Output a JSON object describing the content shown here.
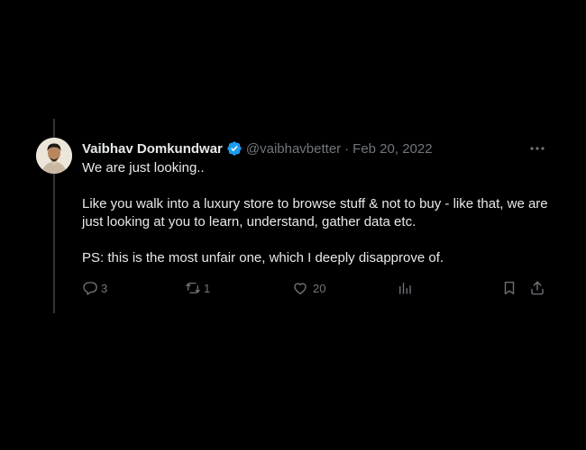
{
  "author": {
    "name": "Vaibhav Domkundwar",
    "handle": "@vaibhavbetter",
    "separator": "·",
    "date": "Feb 20, 2022",
    "verified": true
  },
  "tweet": {
    "paragraphs": [
      "We are just looking..",
      "Like you walk into a luxury store to browse stuff & not to buy - like that, we are just looking at you to learn, understand, gather data etc.",
      "PS: this is the most unfair one, which I deeply disapprove of."
    ]
  },
  "actions": {
    "replies": "3",
    "retweets": "1",
    "likes": "20"
  },
  "colors": {
    "background": "#000000",
    "text": "#e7e9ea",
    "muted": "#71767b",
    "verified": "#1d9bf0",
    "thread_line": "#333639"
  },
  "icons": [
    "verified-badge-icon",
    "more-options-icon",
    "reply-icon",
    "retweet-icon",
    "like-icon",
    "views-icon",
    "bookmark-icon",
    "share-icon"
  ]
}
